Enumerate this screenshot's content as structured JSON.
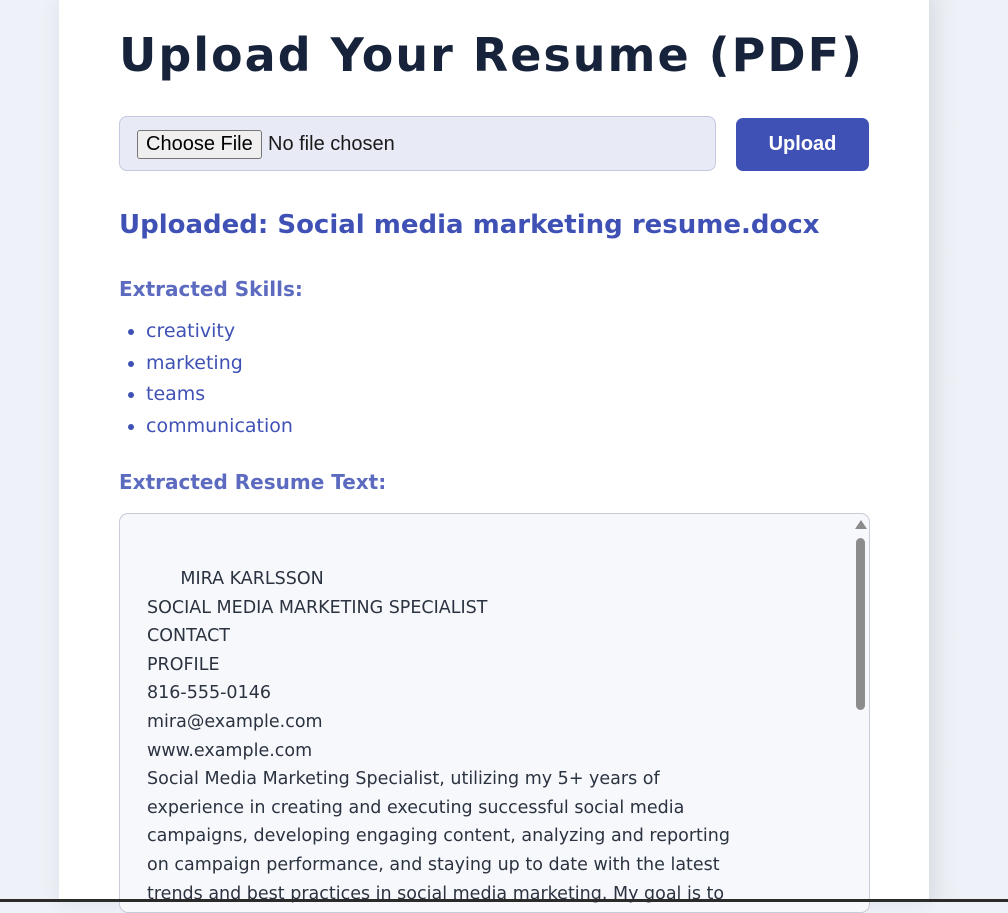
{
  "page": {
    "title": "Upload Your Resume (PDF)"
  },
  "upload_form": {
    "choose_file_label": "Choose File",
    "file_status": "No file chosen",
    "upload_label": "Upload"
  },
  "result": {
    "uploaded_heading": "Uploaded: Social media marketing resume.docx",
    "skills_heading": "Extracted Skills:",
    "skills": [
      "creativity",
      "marketing",
      "teams",
      "communication"
    ],
    "text_heading": "Extracted Resume Text:",
    "resume_text": "      MIRA KARLSSON\nSOCIAL MEDIA MARKETING SPECIALIST\nCONTACT\nPROFILE\n816-555-0146\nmira@example.com\nwww.example.com\nSocial Media Marketing Specialist, utilizing my 5+ years of experience in creating and executing successful social media campaigns, developing engaging content, analyzing and reporting on campaign performance, and staying up to date with the latest trends and best practices in social media marketing. My goal is to"
  },
  "colors": {
    "accent": "#3f51b5",
    "subheading": "#5c6bc0",
    "title": "#16233b"
  }
}
